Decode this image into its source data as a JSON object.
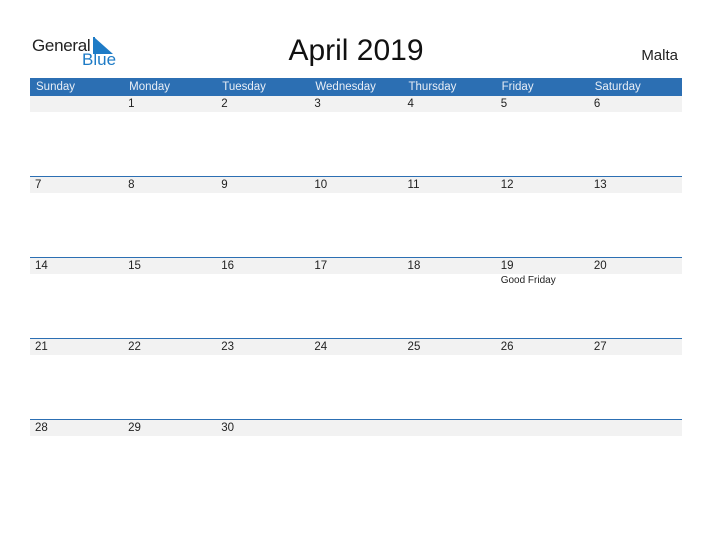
{
  "logo": {
    "text1": "General",
    "text2": "Blue"
  },
  "title": "April 2019",
  "country": "Malta",
  "colors": {
    "header_bg": "#2c6fb3",
    "strip_bg": "#f2f2f2",
    "logo_blue": "#1e7bc6"
  },
  "weekdays": [
    "Sunday",
    "Monday",
    "Tuesday",
    "Wednesday",
    "Thursday",
    "Friday",
    "Saturday"
  ],
  "weeks": [
    [
      {
        "d": ""
      },
      {
        "d": "1"
      },
      {
        "d": "2"
      },
      {
        "d": "3"
      },
      {
        "d": "4"
      },
      {
        "d": "5"
      },
      {
        "d": "6"
      }
    ],
    [
      {
        "d": "7"
      },
      {
        "d": "8"
      },
      {
        "d": "9"
      },
      {
        "d": "10"
      },
      {
        "d": "11"
      },
      {
        "d": "12"
      },
      {
        "d": "13"
      }
    ],
    [
      {
        "d": "14"
      },
      {
        "d": "15"
      },
      {
        "d": "16"
      },
      {
        "d": "17"
      },
      {
        "d": "18"
      },
      {
        "d": "19",
        "event": "Good Friday"
      },
      {
        "d": "20"
      }
    ],
    [
      {
        "d": "21"
      },
      {
        "d": "22"
      },
      {
        "d": "23"
      },
      {
        "d": "24"
      },
      {
        "d": "25"
      },
      {
        "d": "26"
      },
      {
        "d": "27"
      }
    ],
    [
      {
        "d": "28"
      },
      {
        "d": "29"
      },
      {
        "d": "30"
      },
      {
        "d": ""
      },
      {
        "d": ""
      },
      {
        "d": ""
      },
      {
        "d": ""
      }
    ]
  ]
}
